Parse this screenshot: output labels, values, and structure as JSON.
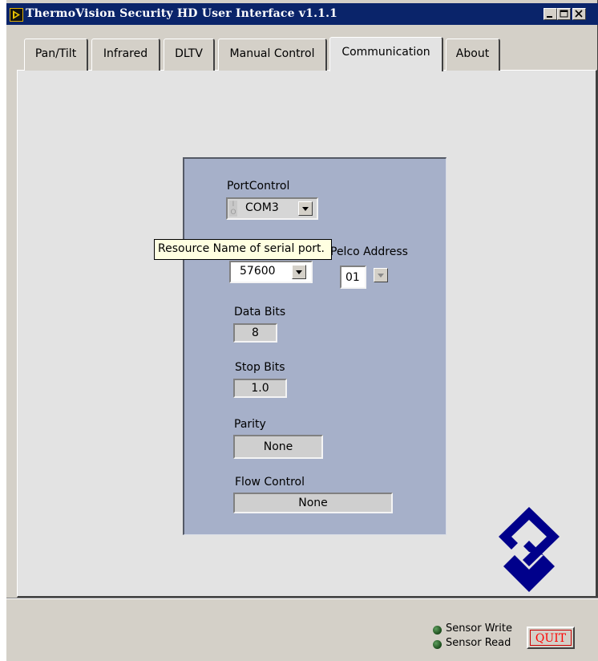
{
  "window": {
    "title": "ThermoVision Security HD User Interface v1.1.1"
  },
  "tabs": [
    {
      "label": "Pan/Tilt"
    },
    {
      "label": "Infrared"
    },
    {
      "label": "DLTV"
    },
    {
      "label": "Manual Control"
    },
    {
      "label": "Communication",
      "active": true
    },
    {
      "label": "About"
    }
  ],
  "comm": {
    "port_control_label": "PortControl",
    "port_control_value": "COM3",
    "baud_value": "57600",
    "pelco_address_label": "Pelco Address",
    "pelco_address_value": "01",
    "data_bits_label": "Data Bits",
    "data_bits_value": "8",
    "stop_bits_label": "Stop Bits",
    "stop_bits_value": "1.0",
    "parity_label": "Parity",
    "parity_value": "None",
    "flow_control_label": "Flow Control",
    "flow_control_value": "None"
  },
  "tooltip": "Resource Name of serial port.",
  "status": {
    "sensor_write": "Sensor Write",
    "sensor_read": "Sensor Read"
  },
  "quit_label": "QUIT",
  "colors": {
    "titlebar": "#0a246a",
    "panel": "#a6b0c9",
    "logo": "#00008b",
    "quit_text": "#ff0000"
  }
}
